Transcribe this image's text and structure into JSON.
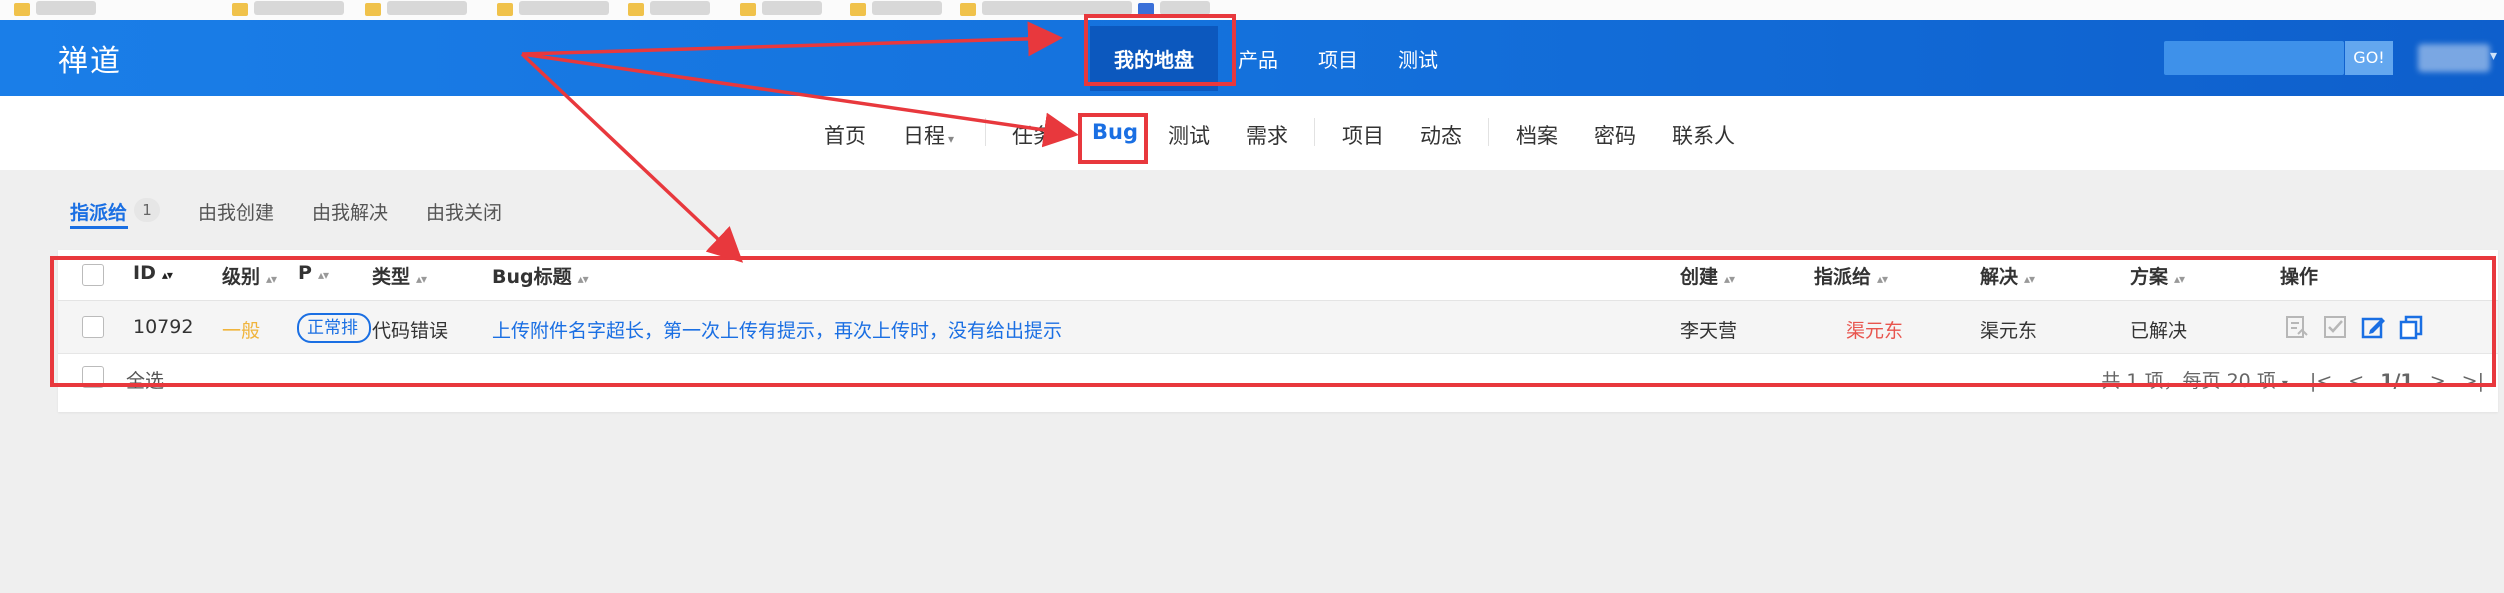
{
  "brand": "禅道",
  "main_nav": [
    {
      "label": "我的地盘",
      "active": true
    },
    {
      "label": "产品",
      "active": false
    },
    {
      "label": "项目",
      "active": false
    },
    {
      "label": "测试",
      "active": false
    }
  ],
  "search": {
    "button": "GO!"
  },
  "sub_nav": {
    "home": "首页",
    "schedule": "日程",
    "task": "任务",
    "bug": "Bug",
    "test": "测试",
    "requirement": "需求",
    "project": "项目",
    "dynamic": "动态",
    "archive": "档案",
    "password": "密码",
    "contacts": "联系人"
  },
  "tabs": {
    "assigned": "指派给",
    "assigned_count": "1",
    "created": "由我创建",
    "resolved": "由我解决",
    "closed": "由我关闭"
  },
  "columns": {
    "id": "ID",
    "severity": "级别",
    "priority": "P",
    "type": "类型",
    "title": "Bug标题",
    "creator": "创建",
    "assigned_to": "指派给",
    "resolver": "解决",
    "solution": "方案",
    "actions": "操作"
  },
  "rows": [
    {
      "id": "10792",
      "severity": "一般",
      "priority": "正常排",
      "type": "代码错误",
      "title": "上传附件名字超长，第一次上传有提示，再次上传时，没有给出提示",
      "creator": "李天营",
      "assigned_to": "渠元东",
      "resolver": "渠元东",
      "solution": "已解决"
    }
  ],
  "footer": {
    "select_all": "全选",
    "pager": "共 1 项，每页 20 项",
    "page": "1/1"
  },
  "annotation_color": "#e8383d"
}
